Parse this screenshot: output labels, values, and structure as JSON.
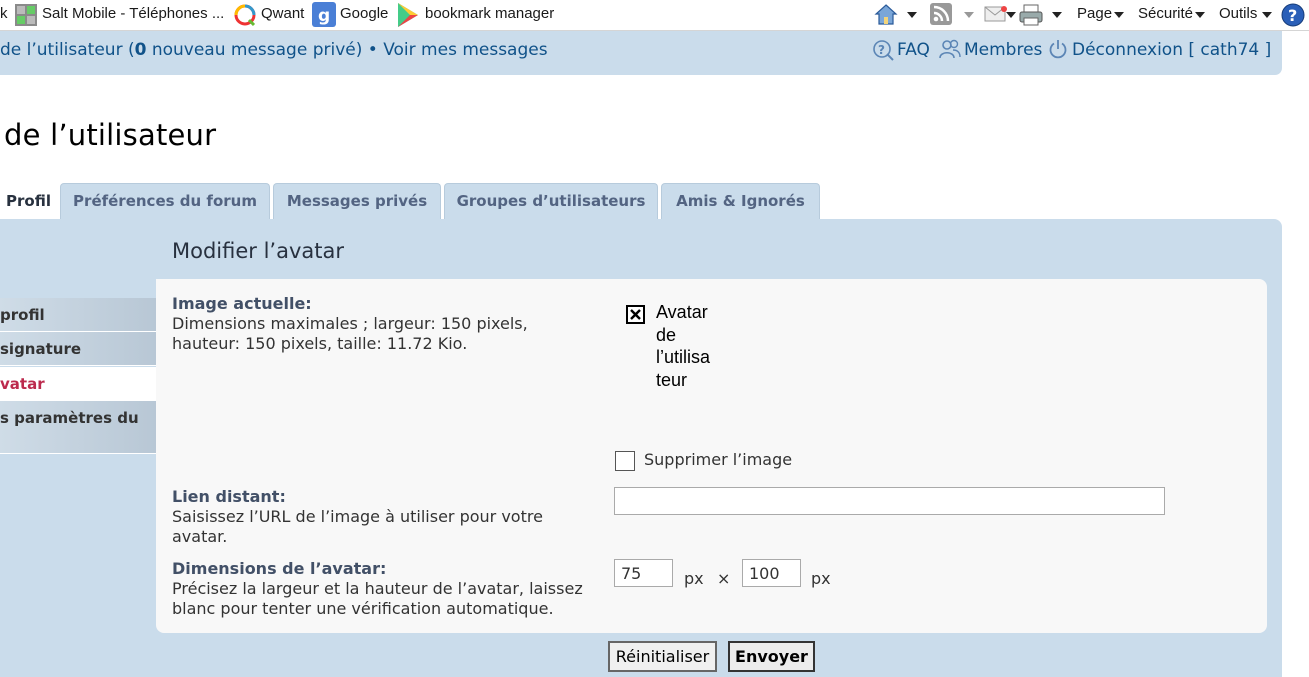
{
  "browser_bar": {
    "links": [
      {
        "label": "k"
      },
      {
        "label": "Salt Mobile - Téléphones ..."
      },
      {
        "label": "Qwant"
      },
      {
        "label": "Google"
      },
      {
        "label": "bookmark manager"
      }
    ],
    "menus": {
      "page": "Page",
      "security": "Sécurité",
      "tools": "Outils"
    }
  },
  "navbar": {
    "user_panel_prefix": "de l’utilisateur (",
    "new_pm_count": "0",
    "new_pm_suffix": " nouveau message privé)",
    "separator": " • ",
    "view_messages": "Voir mes messages",
    "faq": "FAQ",
    "members": "Membres",
    "logout": "Déconnexion",
    "username": "[ cath74 ]"
  },
  "page_title": "de l’utilisateur",
  "tabs": [
    {
      "label": "Profil",
      "active": true
    },
    {
      "label": "Préférences du forum"
    },
    {
      "label": "Messages privés"
    },
    {
      "label": "Groupes d’utilisateurs"
    },
    {
      "label": "Amis & Ignorés"
    }
  ],
  "sidebar": {
    "items": [
      {
        "label": "profil"
      },
      {
        "label": "signature"
      },
      {
        "label": "vatar",
        "active": true
      },
      {
        "label": "s paramètres du"
      }
    ]
  },
  "section_title": "Modifier l’avatar",
  "form": {
    "current_image": {
      "title": "Image actuelle:",
      "desc_line1": "Dimensions maximales ; largeur: 150 pixels,",
      "desc_line2": "hauteur: 150 pixels, taille: 11.72 Kio.",
      "placeholder_lines": [
        "Avatar",
        "de",
        "l’utilisa",
        "teur"
      ]
    },
    "delete_label": "Supprimer l’image",
    "delete_checked": false,
    "remote": {
      "title": "Lien distant:",
      "desc_line1": "Saisissez l’URL de l’image à utiliser pour votre",
      "desc_line2": "avatar.",
      "value": ""
    },
    "dimensions": {
      "title": "Dimensions de l’avatar:",
      "desc_line1": "Précisez la largeur et la hauteur de l’avatar, laissez",
      "desc_line2": "blanc pour tenter une vérification automatique.",
      "width": "75",
      "height": "100",
      "unit": "px",
      "times": "×"
    }
  },
  "buttons": {
    "reset": "Réinitialiser",
    "submit": "Envoyer"
  },
  "colors": {
    "nav_bg": "#cadceb",
    "link": "#105289",
    "active_side": "#bc2a4d"
  }
}
